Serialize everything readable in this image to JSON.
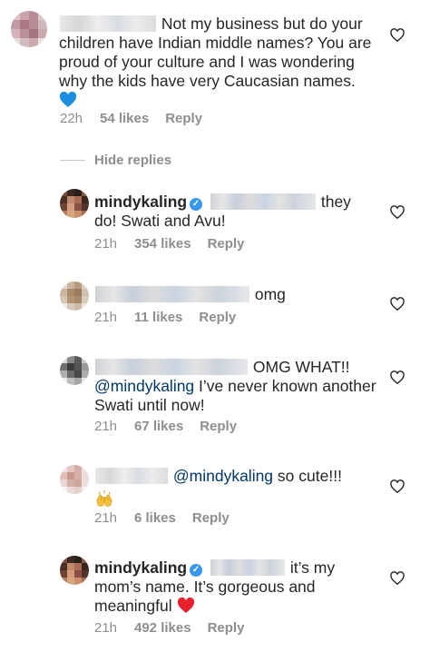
{
  "top_comment": {
    "text": "Not my business but do your children have Indian middle names? You are proud of your culture and I was wondering why the kids have very Caucasian names.",
    "emoji": "blue-heart",
    "time": "22h",
    "likes": "54 likes",
    "reply": "Reply"
  },
  "hide_replies": "Hide replies",
  "replies": [
    {
      "username": "mindykaling",
      "verified": true,
      "text": "they do! Swati and Avu!",
      "time": "21h",
      "likes": "354 likes",
      "reply": "Reply"
    },
    {
      "text": "omg",
      "time": "21h",
      "likes": "11 likes",
      "reply": "Reply"
    },
    {
      "text_before": "OMG WHAT!!",
      "mention": "@mindykaling",
      "text_after": "I’ve never known another Swati until now!",
      "time": "21h",
      "likes": "67 likes",
      "reply": "Reply"
    },
    {
      "mention": "@mindykaling",
      "text": "so cute!!!",
      "emoji": "raising-hands",
      "time": "21h",
      "likes": "6 likes",
      "reply": "Reply"
    },
    {
      "username": "mindykaling",
      "verified": true,
      "text": "it’s my mom’s name. It’s gorgeous and meaningful",
      "emoji": "red-heart",
      "time": "21h",
      "likes": "492 likes",
      "reply": "Reply"
    }
  ],
  "colors": {
    "text": "#262626",
    "meta": "#8e8e8e",
    "mention": "#00376b",
    "verified": "#3897f0",
    "red_heart": "#e8212d",
    "blue_heart": "#1d8fe1"
  }
}
